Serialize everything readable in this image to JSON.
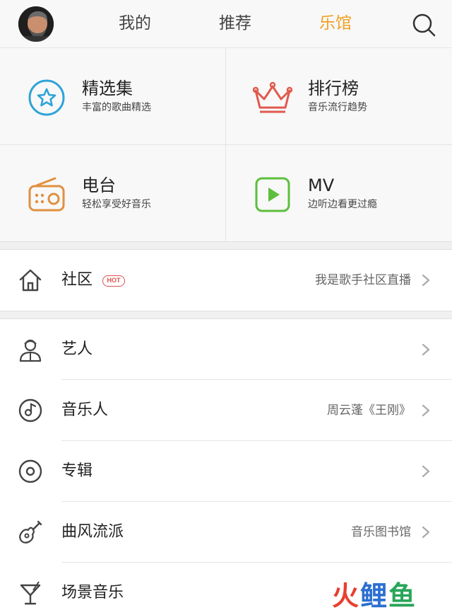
{
  "header": {
    "tabs": [
      {
        "label": "我的",
        "active": false
      },
      {
        "label": "推荐",
        "active": false
      },
      {
        "label": "乐馆",
        "active": true
      }
    ],
    "accent_color": "#f0a024",
    "avatar_icon": "user-avatar",
    "search_icon": "search-icon"
  },
  "grid": [
    {
      "title": "精选集",
      "subtitle": "丰富的歌曲精选",
      "icon": "star-circle-icon",
      "color": "#2ea3d8"
    },
    {
      "title": "排行榜",
      "subtitle": "音乐流行趋势",
      "icon": "crown-icon",
      "color": "#e05a4e"
    },
    {
      "title": "电台",
      "subtitle": "轻松享受好音乐",
      "icon": "radio-icon",
      "color": "#e09040"
    },
    {
      "title": "MV",
      "subtitle": "边听边看更过瘾",
      "icon": "play-icon",
      "color": "#5cbf3c"
    }
  ],
  "community": {
    "label": "社区",
    "badge": "HOT",
    "detail": "我是歌手社区直播",
    "icon": "home-icon"
  },
  "rows": [
    {
      "label": "艺人",
      "detail": "",
      "icon": "singer-icon"
    },
    {
      "label": "音乐人",
      "detail": "周云蓬《王刚》",
      "icon": "music-disc-icon"
    },
    {
      "label": "专辑",
      "detail": "",
      "icon": "album-icon"
    },
    {
      "label": "曲风流派",
      "detail": "音乐图书馆",
      "icon": "guitar-icon"
    },
    {
      "label": "场景音乐",
      "detail": "",
      "icon": "cocktail-icon"
    }
  ],
  "watermark": {
    "part1": "火",
    "part2": "鲤",
    "part3": "鱼"
  }
}
